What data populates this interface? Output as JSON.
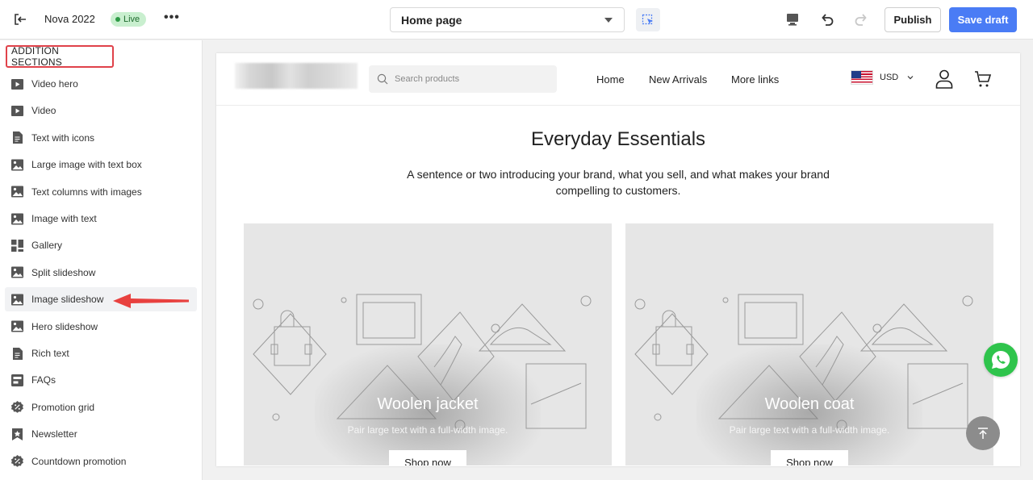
{
  "topbar": {
    "store_name": "Nova 2022",
    "live_label": "Live",
    "more_label": "•••",
    "page_select": "Home page",
    "publish_label": "Publish",
    "save_label": "Save draft"
  },
  "sidebar": {
    "heading": "ADDITION SECTIONS",
    "items": [
      {
        "label": "Video hero",
        "icon": "play-icon"
      },
      {
        "label": "Video",
        "icon": "play-icon"
      },
      {
        "label": "Text with icons",
        "icon": "document-icon"
      },
      {
        "label": "Large image with text box",
        "icon": "image-icon"
      },
      {
        "label": "Text columns with images",
        "icon": "image-icon"
      },
      {
        "label": "Image with text",
        "icon": "image-icon"
      },
      {
        "label": "Gallery",
        "icon": "grid-icon"
      },
      {
        "label": "Split slideshow",
        "icon": "image-icon"
      },
      {
        "label": "Image slideshow",
        "icon": "image-icon"
      },
      {
        "label": "Hero slideshow",
        "icon": "image-icon"
      },
      {
        "label": "Rich text",
        "icon": "document-icon"
      },
      {
        "label": "FAQs",
        "icon": "faq-icon"
      },
      {
        "label": "Promotion grid",
        "icon": "percent-icon"
      },
      {
        "label": "Newsletter",
        "icon": "star-badge-icon"
      },
      {
        "label": "Countdown promotion",
        "icon": "percent-icon"
      }
    ],
    "active_item": "Image slideshow",
    "highlight_color": "#e0424a"
  },
  "store": {
    "search_placeholder": "Search products",
    "nav": [
      "Home",
      "New Arrivals",
      "More links"
    ],
    "currency": "USD",
    "hero_title": "Everyday Essentials",
    "hero_subtitle": "A sentence or two introducing your brand, what you sell, and what makes your brand compelling to customers.",
    "cards": [
      {
        "title": "Woolen jacket",
        "description": "Pair large text with a full-width image.",
        "button": "Shop now"
      },
      {
        "title": "Woolen coat",
        "description": "Pair large text with a full-width image.",
        "button": "Shop now"
      }
    ]
  },
  "colors": {
    "primary": "#4a7cf5",
    "live_badge": "#c9efcf",
    "whatsapp": "#2fc44c"
  }
}
